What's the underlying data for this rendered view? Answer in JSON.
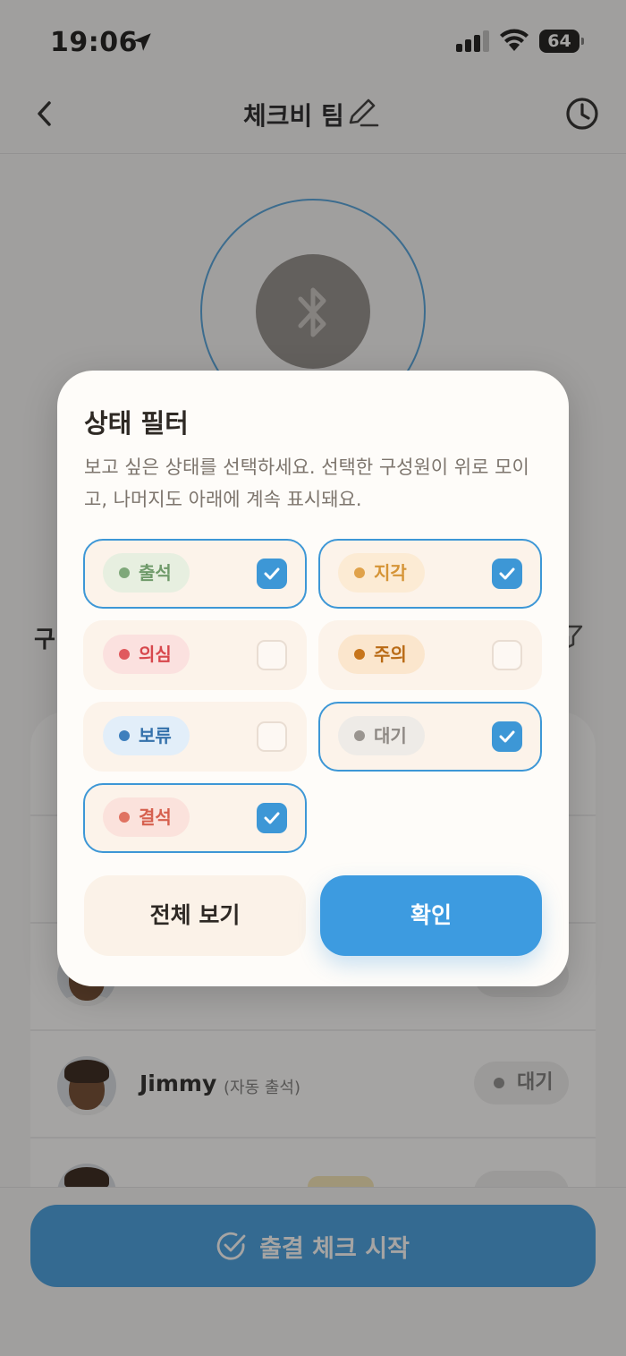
{
  "status_bar": {
    "time": "19:06",
    "battery": "64",
    "icons": [
      "location-arrow-icon",
      "signal-bars-icon",
      "wifi-icon",
      "battery-icon"
    ]
  },
  "nav": {
    "title": "체크비 팀",
    "icons": [
      "chevron-left-icon",
      "pencil-icon",
      "clock-icon"
    ]
  },
  "background": {
    "bluetooth_icon": "bluetooth-icon",
    "section_title_peek": "구",
    "members": [
      {
        "name": "Jimmy",
        "note": "(자동 출석)",
        "status": "대기"
      }
    ],
    "start_button_label": "출결 체크 시작"
  },
  "filter_modal": {
    "title": "상태 필터",
    "description": "보고 싶은 상태를 선택하세요. 선택한 구성원이 위로 모이고, 나머지도 아래에 계속 표시돼요.",
    "options": [
      {
        "label": "출석",
        "selected": true,
        "dot_color": "#7fa87a",
        "chip_bg": "#e7efe0",
        "text_color": "#6f9a6a"
      },
      {
        "label": "지각",
        "selected": true,
        "dot_color": "#e0a24a",
        "chip_bg": "#fcebd4",
        "text_color": "#d59436"
      },
      {
        "label": "의심",
        "selected": false,
        "dot_color": "#e0595e",
        "chip_bg": "#fbe1df",
        "text_color": "#d7474c"
      },
      {
        "label": "주의",
        "selected": false,
        "dot_color": "#c7751b",
        "chip_bg": "#fbe6cd",
        "text_color": "#b96a14"
      },
      {
        "label": "보류",
        "selected": false,
        "dot_color": "#3d7fbd",
        "chip_bg": "#e2eef9",
        "text_color": "#3471ab"
      },
      {
        "label": "대기",
        "selected": true,
        "dot_color": "#9a9590",
        "chip_bg": "#eeebe7",
        "text_color": "#8e8984"
      },
      {
        "label": "결석",
        "selected": true,
        "dot_color": "#e07261",
        "chip_bg": "#fbe2dc",
        "text_color": "#d6604e"
      }
    ],
    "buttons": {
      "show_all": "전체 보기",
      "confirm": "확인"
    },
    "accent_color": "#3d97d6"
  }
}
